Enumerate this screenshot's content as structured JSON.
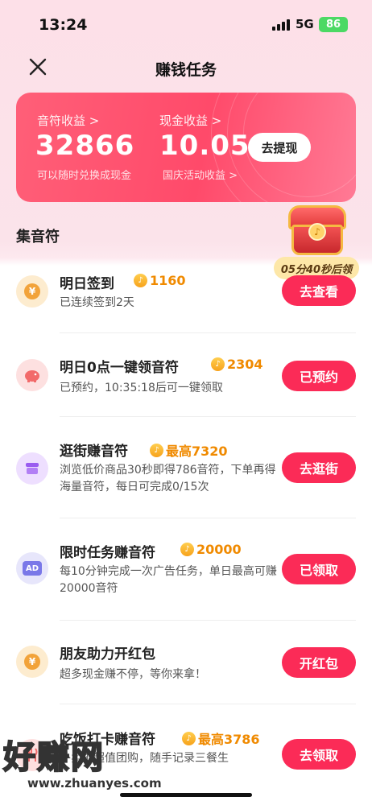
{
  "status_bar": {
    "time": "13:24",
    "network": "5G",
    "battery": "86"
  },
  "nav": {
    "title": "赚钱任务"
  },
  "earnings": {
    "notes_label": "音符收益 >",
    "notes_value": "32866",
    "notes_sub": "可以随时兑换成现金",
    "cash_label": "现金收益 >",
    "cash_value": "10.05",
    "cash_sub": "国庆活动收益 >",
    "withdraw_label": "去提现"
  },
  "section": {
    "title": "集音符"
  },
  "treasure": {
    "timer": "05分40秒后领"
  },
  "tasks": [
    {
      "title": "明日签到",
      "reward": "1160",
      "desc": "已连续签到2天",
      "button": "去查看",
      "icon": "yen-coin-icon"
    },
    {
      "title": "明日0点一键领音符",
      "reward": "2304",
      "desc": "已预约，10:35:18后可一键领取",
      "button": "已预约",
      "icon": "piggy-bank-icon"
    },
    {
      "title": "逛街赚音符",
      "reward": "最高7320",
      "desc": "浏览低价商品30秒即得786音符，下单再得海量音符，每日可完成0/15次",
      "button": "去逛街",
      "icon": "shop-icon"
    },
    {
      "title": "限时任务赚音符",
      "reward": "20000",
      "desc": "每10分钟完成一次广告任务，单日最高可赚20000音符",
      "button": "已领取",
      "icon": "ad-icon",
      "icon_text": "AD"
    },
    {
      "title": "朋友助力开红包",
      "reward": "",
      "desc": "超多现金赚不停，等你来拿！",
      "button": "开红包",
      "icon": "yen-coin-icon"
    },
    {
      "title": "吃饭打卡赚音符",
      "reward": "最高3786",
      "desc": "外卖逛超值团购，随手记录三餐生",
      "button": "去领取",
      "icon": "meal-icon"
    }
  ],
  "watermark": {
    "brand": "好赚网",
    "url": "www.zhuanyes.com"
  },
  "colors": {
    "accent": "#fb2b57",
    "reward": "#f08a00",
    "card": "#ff4a6a"
  }
}
